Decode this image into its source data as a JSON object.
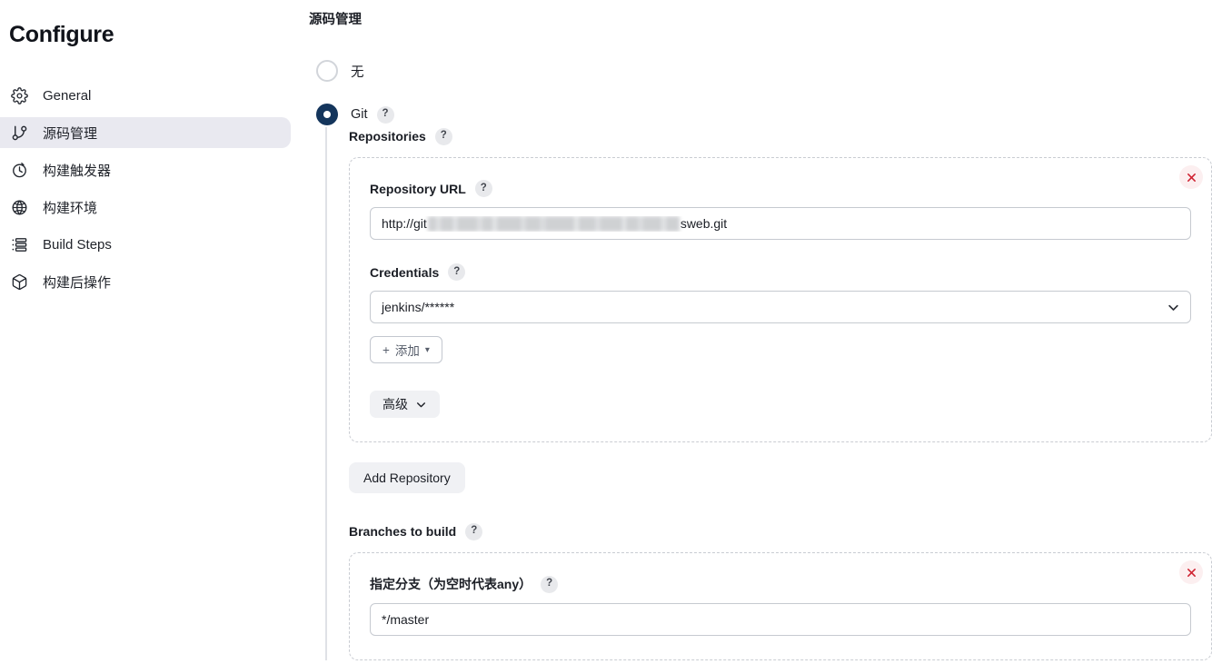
{
  "sidebar": {
    "title": "Configure",
    "items": [
      {
        "label": "General",
        "icon": "gear-icon",
        "active": false
      },
      {
        "label": "源码管理",
        "icon": "git-branch-icon",
        "active": true
      },
      {
        "label": "构建触发器",
        "icon": "clock-icon",
        "active": false
      },
      {
        "label": "构建环境",
        "icon": "globe-icon",
        "active": false
      },
      {
        "label": "Build Steps",
        "icon": "list-icon",
        "active": false
      },
      {
        "label": "构建后操作",
        "icon": "package-icon",
        "active": false
      }
    ]
  },
  "main": {
    "section_heading": "源码管理",
    "scm_options": [
      {
        "label": "无",
        "selected": false,
        "has_help": false
      },
      {
        "label": "Git",
        "selected": true,
        "has_help": true
      }
    ],
    "help_glyph": "?",
    "repositories": {
      "label": "Repositories",
      "repo": {
        "url_field": {
          "label": "Repository URL",
          "value_prefix": "http://git",
          "value_suffix": "sweb.git",
          "redacted": true
        },
        "credentials_field": {
          "label": "Credentials",
          "value": "jenkins/******",
          "chevron": "chevron-down-icon"
        },
        "add_credentials_button": {
          "label": "添加",
          "plus": "+",
          "caret": "▾"
        },
        "advanced_button": {
          "label": "高级",
          "chevron": "chevron-down-icon"
        },
        "delete_button": "close-icon"
      },
      "add_repository_button": "Add Repository"
    },
    "branches": {
      "label": "Branches to build",
      "branch_field": {
        "label": "指定分支（为空时代表any）",
        "value": "*/master"
      },
      "delete_button": "close-icon"
    }
  },
  "colors": {
    "accent_selected": "#14355c",
    "sidebar_active_bg": "#e9e9f0",
    "danger": "#cf2231",
    "danger_bg": "#fceff0",
    "border": "#c6cad0",
    "dashed_border": "#c9ccd2"
  }
}
